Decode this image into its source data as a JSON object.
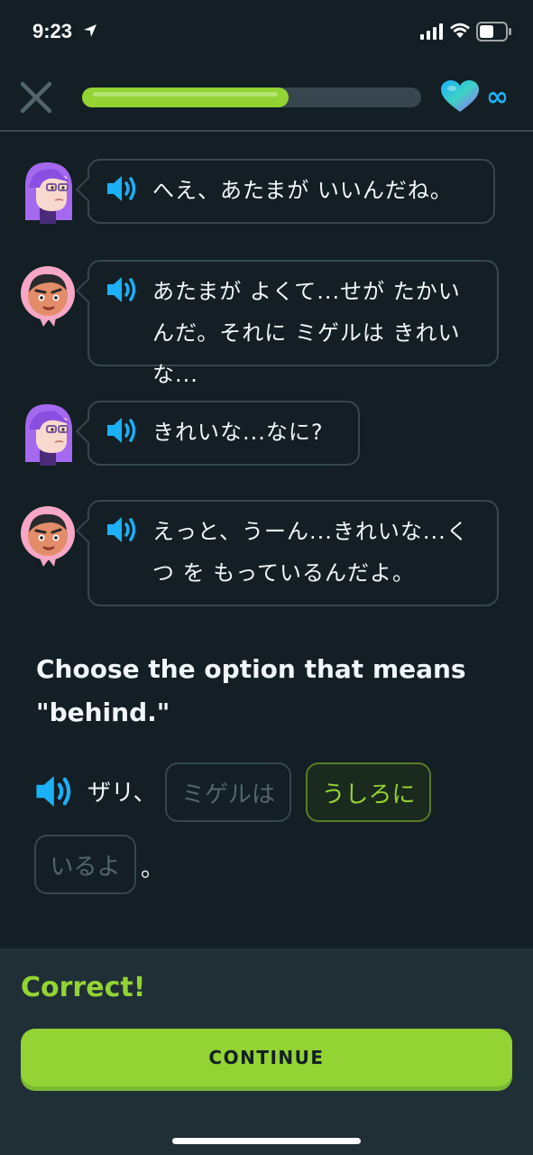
{
  "status_bar": {
    "time": "9:23"
  },
  "header": {
    "progress_fraction": 0.61,
    "infinity_symbol": "∞",
    "icons": {
      "close": "close-icon",
      "heart": "heart-icon"
    },
    "colors": {
      "progress": "#93d333",
      "track": "#37464f",
      "heart": "#1cb0f6"
    }
  },
  "chat": [
    {
      "speaker": "purple-hair-character",
      "text": "へえ、あたまが いいんだね。"
    },
    {
      "speaker": "pink-hood-character",
      "text": "あたまが よくて...せが たかいんだ。それに ミゲルは きれいな..."
    },
    {
      "speaker": "purple-hair-character",
      "text": "きれいな...なに?"
    },
    {
      "speaker": "pink-hood-character",
      "text": "えっと、うーん...きれいな...くつ を もっているんだよ。"
    }
  ],
  "question": {
    "text": "Choose the option that means \"behind.\""
  },
  "answer": {
    "prefix": "ザリ、",
    "options": [
      "ミゲルは",
      "うしろに",
      "いるよ"
    ],
    "selected": "うしろに",
    "suffix": "。"
  },
  "footer": {
    "result": "Correct!",
    "continue_label": "CONTINUE",
    "colors": {
      "success": "#93d333",
      "background": "#202f36"
    }
  }
}
